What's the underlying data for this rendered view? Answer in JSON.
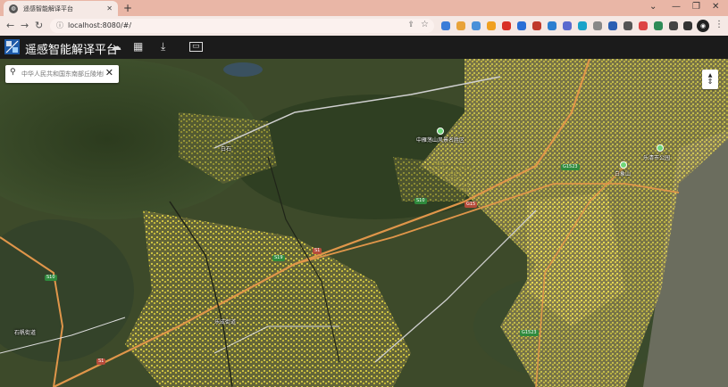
{
  "browser": {
    "tab_title": "遥感智能解译平台",
    "url": "localhost:8080/#/",
    "new_tab": "+",
    "tab_close": "✕"
  },
  "app": {
    "title": "遥感智能解译平台"
  },
  "search": {
    "placeholder": "中华人民共和国东南部丘陵地区某市"
  },
  "map": {
    "places": [
      "中雁荡山风景名胜区",
      "乐清市公园",
      "白象山",
      "石帆街道",
      "乐成街道",
      "白石"
    ],
    "roads": [
      "S10",
      "G1523",
      "G15",
      "S1",
      "S19",
      "S10",
      "G1523",
      "S1"
    ]
  },
  "colors": {
    "tabstrip": "#e9b6a6",
    "appbar": "#1b1b1b",
    "logo": "#1e5aa8"
  }
}
